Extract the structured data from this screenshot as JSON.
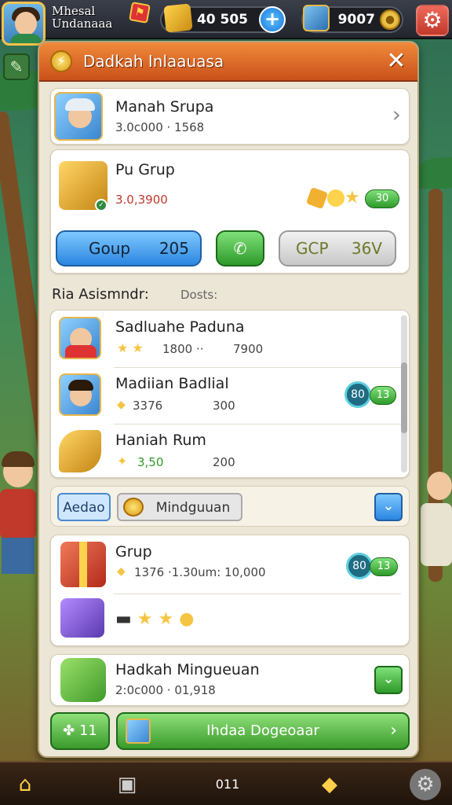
{
  "player": {
    "name": "Mhesal Undanaaa",
    "rank_icon": "flag-icon"
  },
  "resources": [
    {
      "value": "40 505",
      "icon": "gold-crate-icon"
    },
    {
      "value": "9007",
      "icon": "map-icon"
    }
  ],
  "panel": {
    "title": "Dadkah Inlaauasa",
    "profile_card": {
      "title": "Manah Srupa",
      "subtitle": "3.0c000 · 1568"
    },
    "group_card": {
      "title": "Pu Grup",
      "amount": "3.0,3900",
      "reward_pill": "30",
      "buttons": {
        "primary_label": "Goup",
        "primary_value": "205",
        "secondary_label": "GCP",
        "secondary_value": "36V"
      }
    },
    "section": {
      "label": "Ria Asismndr:",
      "sub_label": "Dosts:"
    },
    "list": [
      {
        "title": "Sadluahe Paduna",
        "stat_a": "1800 ··",
        "stat_b": "7900"
      },
      {
        "title": "Madiian Badlial",
        "stat_a": "3376",
        "stat_b": "300",
        "ring": "80",
        "pill": "13"
      },
      {
        "title": "Haniah Rum",
        "stat_a": "3,50",
        "stat_b": "200"
      }
    ],
    "tabs": {
      "tab_a": "Aedao",
      "tab_b": "Mindguuan"
    },
    "grup_card": {
      "title": "Grup",
      "stats": "1376 ·1.30um: 10,000",
      "ring": "80",
      "pill": "13"
    },
    "mingueuan_card": {
      "title": "Hadkah Mingueuan",
      "subtitle": "2:0c000 · 01,918"
    },
    "footer": {
      "small_label": "11",
      "big_label": "Ihdaa Dogeoaar"
    }
  },
  "bottom_nav": {
    "center_label": "011"
  },
  "colors": {
    "header": "#e06a2a",
    "accent_green": "#3a9a2a",
    "accent_blue": "#2b86e0"
  }
}
